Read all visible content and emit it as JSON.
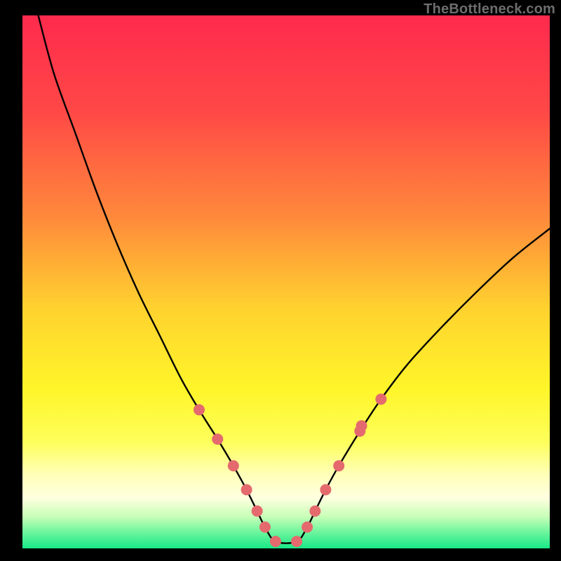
{
  "watermark": {
    "text": "TheBottleneck.com"
  },
  "gradient": {
    "stops": [
      {
        "offset": 0.0,
        "color": "#ff2a4d"
      },
      {
        "offset": 0.18,
        "color": "#ff4846"
      },
      {
        "offset": 0.38,
        "color": "#ff8a3b"
      },
      {
        "offset": 0.55,
        "color": "#ffd22f"
      },
      {
        "offset": 0.7,
        "color": "#fff529"
      },
      {
        "offset": 0.8,
        "color": "#fdff5a"
      },
      {
        "offset": 0.86,
        "color": "#ffffb6"
      },
      {
        "offset": 0.905,
        "color": "#ffffe0"
      },
      {
        "offset": 0.94,
        "color": "#c8ffb8"
      },
      {
        "offset": 0.97,
        "color": "#6cf59c"
      },
      {
        "offset": 1.0,
        "color": "#18e887"
      }
    ]
  },
  "chart_data": {
    "type": "line",
    "title": "",
    "xlabel": "",
    "ylabel": "",
    "xlim": [
      0,
      100
    ],
    "ylim": [
      0,
      100
    ],
    "series": [
      {
        "name": "bottleneck-curve",
        "x": [
          3,
          6,
          10,
          14,
          18,
          22,
          26,
          30,
          33.5,
          37,
          40,
          42.5,
          44.5,
          46,
          48,
          52,
          54,
          55.5,
          57.5,
          60,
          64,
          68,
          73,
          79,
          86,
          93,
          100
        ],
        "y": [
          100,
          89,
          78,
          67,
          57,
          48,
          40,
          32,
          26,
          20.5,
          15.5,
          11,
          7,
          4,
          1.3,
          1.3,
          4,
          7,
          11,
          15.5,
          22,
          28,
          34.5,
          41,
          48,
          54.5,
          60
        ]
      }
    ],
    "markers": {
      "name": "threshold-dots",
      "color": "#e46a6e",
      "radius_px": 8,
      "x": [
        33.5,
        37,
        40,
        42.5,
        44.5,
        46,
        48,
        52,
        54,
        55.5,
        57.5,
        60,
        64,
        64.3,
        68
      ],
      "y": [
        26,
        20.5,
        15.5,
        11,
        7,
        4,
        1.3,
        1.3,
        4,
        7,
        11,
        15.5,
        22,
        23,
        28
      ]
    }
  }
}
